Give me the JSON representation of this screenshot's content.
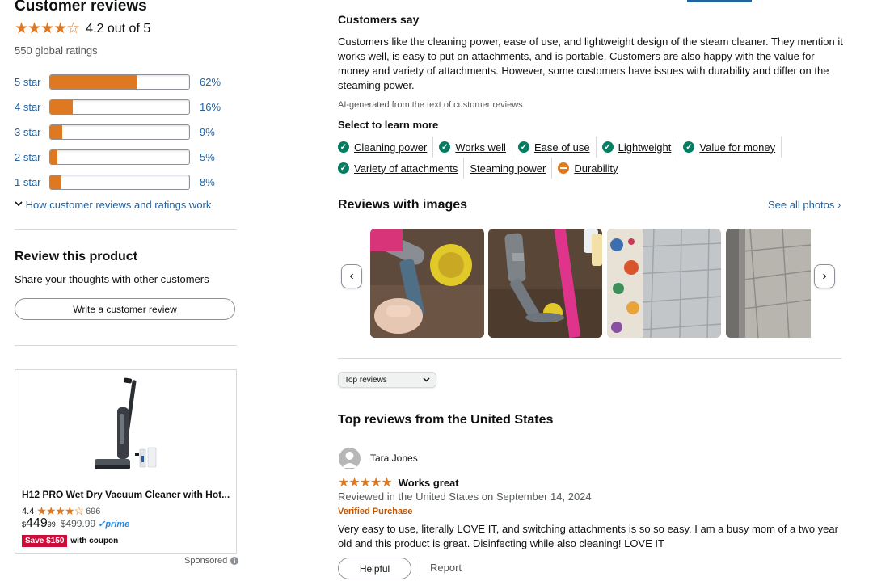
{
  "summary": {
    "title": "Customer reviews",
    "stars": "★★★★☆",
    "rating_text": "4.2 out of 5",
    "global_ratings": "550 global ratings",
    "histogram": [
      {
        "label": "5 star",
        "pct": "62%",
        "value": 62
      },
      {
        "label": "4 star",
        "pct": "16%",
        "value": 16
      },
      {
        "label": "3 star",
        "pct": "9%",
        "value": 9
      },
      {
        "label": "2 star",
        "pct": "5%",
        "value": 5
      },
      {
        "label": "1 star",
        "pct": "8%",
        "value": 8
      }
    ],
    "how_link": "How customer reviews and ratings work"
  },
  "review_product": {
    "title": "Review this product",
    "subtitle": "Share your thoughts with other customers",
    "button": "Write a customer review"
  },
  "ad": {
    "name": "H12 PRO Wet Dry Vacuum Cleaner with Hot...",
    "rating": "4.4",
    "stars": "★★★★☆",
    "count": "696",
    "price_symbol": "$",
    "price_whole": "449",
    "price_fraction": "99",
    "list_price": "$499.99",
    "prime": "✓prime",
    "save_badge": "Save $150",
    "coupon": "with coupon",
    "sponsored": "Sponsored",
    "info": "i"
  },
  "customers_say": {
    "title": "Customers say",
    "text": "Customers like the cleaning power, ease of use, and lightweight design of the steam cleaner. They mention it works well, is easy to put on attachments, and is portable. Customers are also happy with the value for money and variety of attachments. However, some customers have issues with durability and differ on the steaming power.",
    "ai_note": "AI-generated from the text of customer reviews",
    "select_more": "Select to learn more",
    "aspects": [
      {
        "label": "Cleaning power",
        "sentiment": "positive"
      },
      {
        "label": "Works well",
        "sentiment": "positive"
      },
      {
        "label": "Ease of use",
        "sentiment": "positive"
      },
      {
        "label": "Lightweight",
        "sentiment": "positive"
      },
      {
        "label": "Value for money",
        "sentiment": "positive"
      },
      {
        "label": "Variety of attachments",
        "sentiment": "positive"
      },
      {
        "label": "Steaming power",
        "sentiment": "mixed"
      },
      {
        "label": "Durability",
        "sentiment": "negative"
      }
    ]
  },
  "images_section": {
    "title": "Reviews with images",
    "see_all": "See all photos ›",
    "prev": "‹",
    "next": "›"
  },
  "sort": {
    "selected": "Top reviews",
    "chevron": "⌄"
  },
  "top_reviews": {
    "title": "Top reviews from the United States",
    "review": {
      "author": "Tara Jones",
      "stars": "★★★★★",
      "headline": "Works great",
      "date": "Reviewed in the United States on September 14, 2024",
      "verified": "Verified Purchase",
      "body": "Very easy to use, literally LOVE IT, and switching attachments is so so easy. I am a busy mom of a two year old and this product is great. Disinfecting while also cleaning! LOVE IT",
      "helpful": "Helpful",
      "report": "Report"
    }
  },
  "colors": {
    "star": "#de7921",
    "link": "#2162a1",
    "positive": "#067d62",
    "negative": "#e07a1f",
    "save": "#cc0c39"
  }
}
